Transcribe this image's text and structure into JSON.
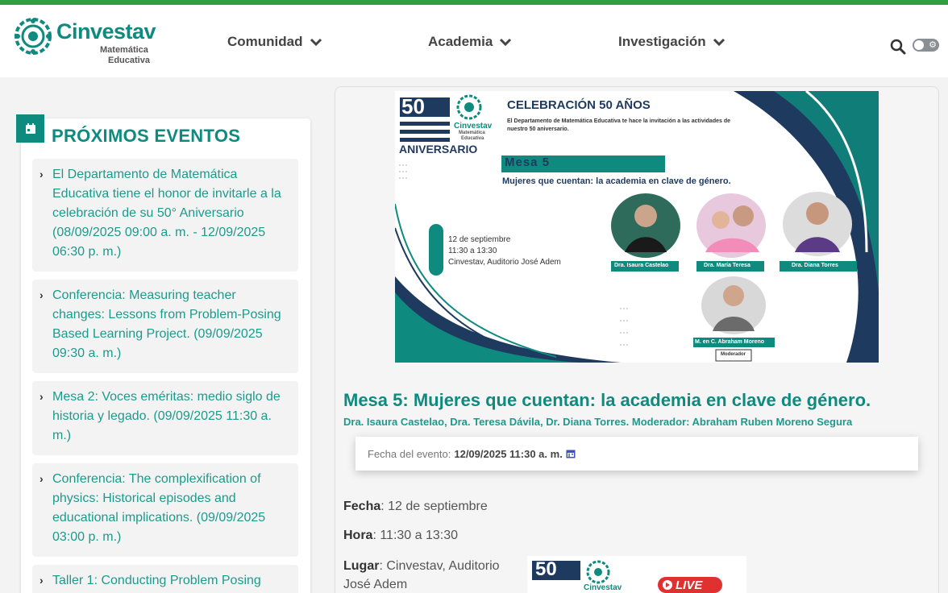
{
  "header": {
    "logo_name": "Cinvestav",
    "logo_sub1": "Matemática",
    "logo_sub2": "Educativa",
    "nav": [
      "Comunidad",
      "Academia",
      "Investigación"
    ]
  },
  "sidebar": {
    "title": "PRÓXIMOS EVENTOS",
    "events": [
      "El Departamento de Matemática Educativa tiene el honor de invitarle a la celebración de su 50° Aniversario (08/09/2025 09:00 a. m. - 12/09/2025 06:30 p. m.)",
      "Conferencia: Measuring teacher changes: Lessons from Problem-Posing Based Learning Project. (09/09/2025 09:30 a. m.)",
      "Mesa 2: Voces eméritas: medio siglo de historia y legado. (09/09/2025 11:30 a. m.)",
      "Conferencia: The complexification of physics: Historical episodes and educational implications. (09/09/2025 03:00 p. m.)",
      "Taller 1: Conducting Problem Posing"
    ]
  },
  "poster": {
    "fifty": "50",
    "brand": "Cinvestav",
    "brand_sub1": "Matemática",
    "brand_sub2": "Educativa",
    "anniversary": "ANIVERSARIO",
    "headline": "CELEBRACIÓN 50 AÑOS",
    "invite_line1": "El Departamento de Matemática Educativa te hace la invitación a las actividades de",
    "invite_line2": "nuestro 50 aniversario.",
    "mesa": "Mesa 5",
    "subtitle": "Mujeres que cuentan: la academia en clave de género.",
    "date": "12 de septiembre",
    "time": "11:30 a 13:30",
    "place": "Cinvestav, Auditorio José Adem",
    "speakers": [
      "Dra. Isaura Castelao",
      "Dra. María Teresa",
      "Dra. Diana Torres",
      "M. en C. Abraham Moreno"
    ],
    "moderator": "Moderador"
  },
  "event": {
    "title": "Mesa 5: Mujeres que cuentan: la academia en clave de género.",
    "speakers": "Dra. Isaura Castelao, Dra. Teresa Dávila, Dr. Diana Torres. Moderador: Abraham Ruben Moreno Segura",
    "date_label": "Fecha del evento:",
    "date_value": "12/09/2025 11:30 a. m.",
    "fecha_label": "Fecha",
    "fecha_value": ": 12 de septiembre",
    "hora_label": "Hora",
    "hora_value": ": 11:30 a 13:30",
    "lugar_label": "Lugar",
    "lugar_value": ": Cinvestav, Auditorio",
    "lugar_value2": "José Adem",
    "live": "LIVE"
  },
  "colors": {
    "accent": "#0f8a7e",
    "topbar": "#2f9e44",
    "navy": "#1f3a5f"
  }
}
